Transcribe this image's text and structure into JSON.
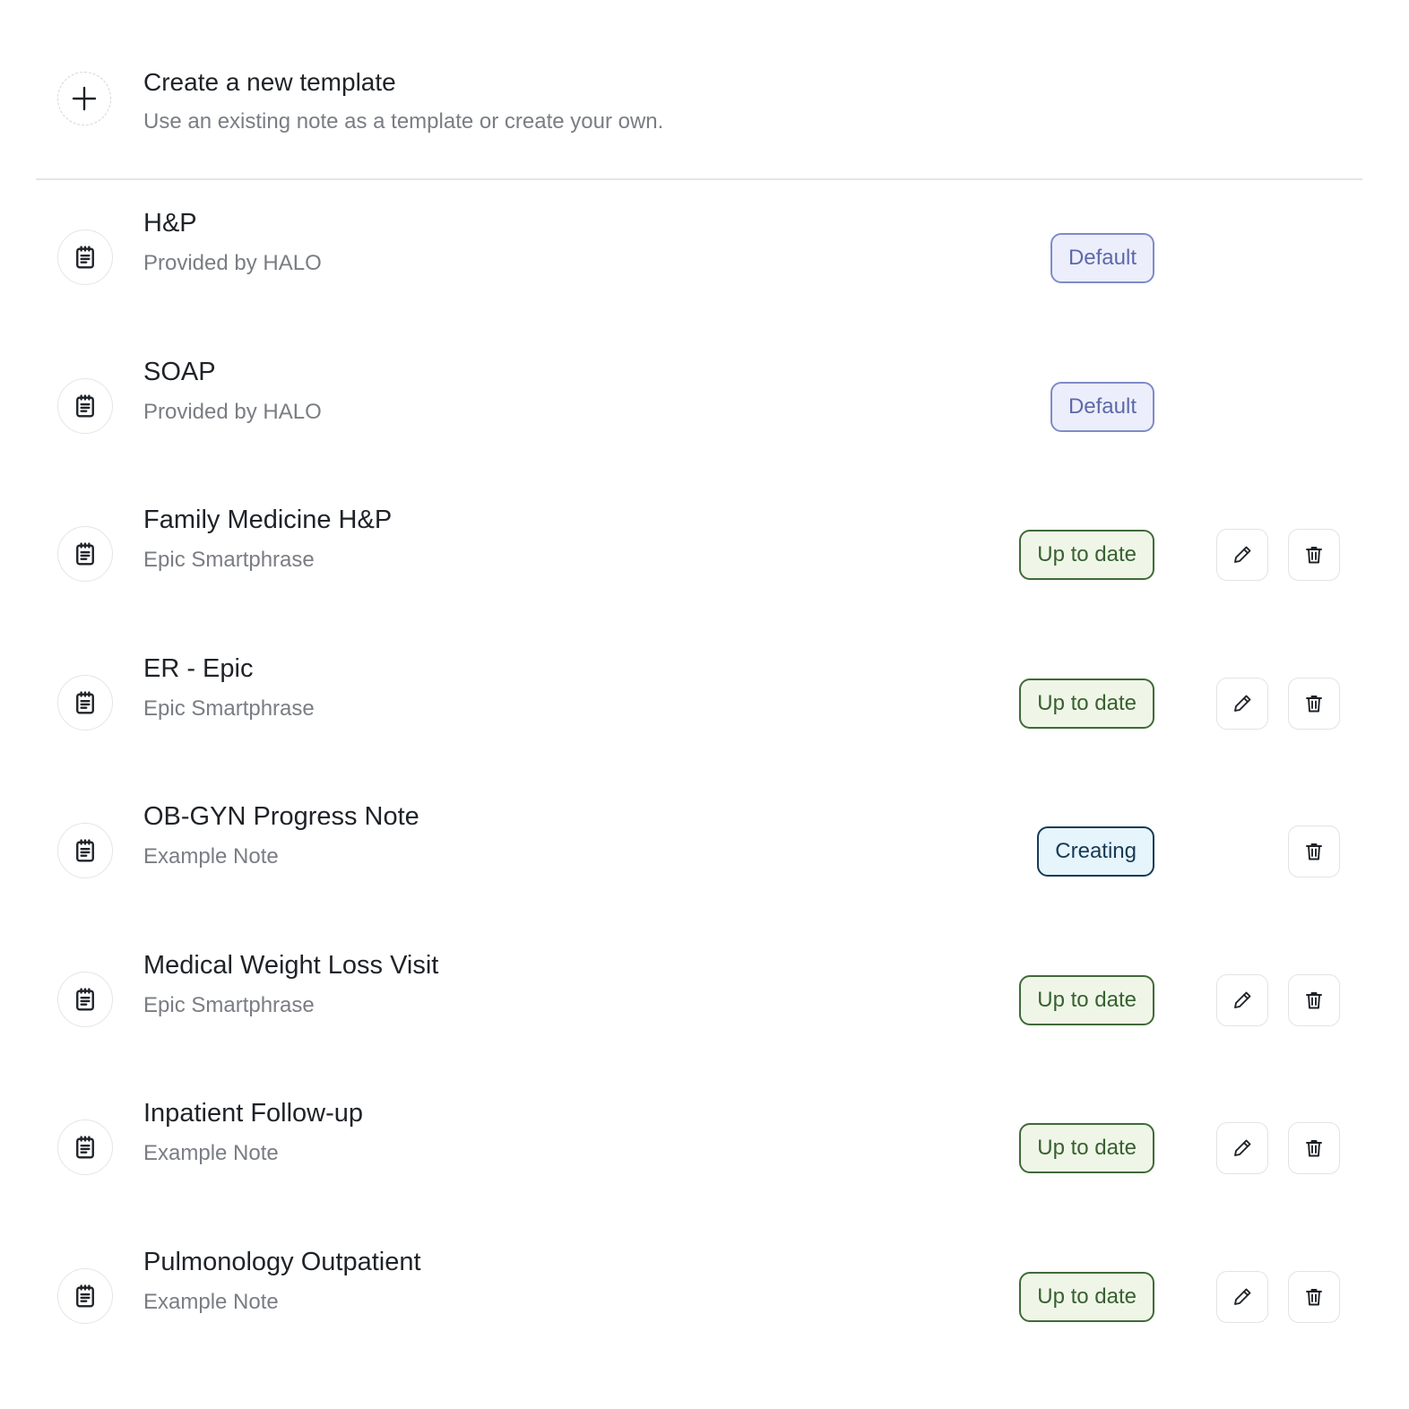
{
  "create": {
    "title": "Create a new template",
    "subtitle": "Use an existing note as a template or create your own.",
    "icon": "plus-icon"
  },
  "templates": [
    {
      "title": "H&P",
      "subtitle": "Provided by HALO",
      "badge": "Default",
      "status": "default",
      "editable": false,
      "deletable": false
    },
    {
      "title": "SOAP",
      "subtitle": "Provided by HALO",
      "badge": "Default",
      "status": "default",
      "editable": false,
      "deletable": false
    },
    {
      "title": "Family Medicine H&P",
      "subtitle": "Epic Smartphrase",
      "badge": "Up to date",
      "status": "uptodate",
      "editable": true,
      "deletable": true
    },
    {
      "title": "ER - Epic",
      "subtitle": "Epic Smartphrase",
      "badge": "Up to date",
      "status": "uptodate",
      "editable": true,
      "deletable": true
    },
    {
      "title": "OB-GYN Progress Note",
      "subtitle": "Example Note",
      "badge": "Creating",
      "status": "creating",
      "editable": false,
      "deletable": true
    },
    {
      "title": "Medical Weight Loss Visit",
      "subtitle": "Epic Smartphrase",
      "badge": "Up to date",
      "status": "uptodate",
      "editable": true,
      "deletable": true
    },
    {
      "title": "Inpatient Follow-up",
      "subtitle": "Example Note",
      "badge": "Up to date",
      "status": "uptodate",
      "editable": true,
      "deletable": true
    },
    {
      "title": "Pulmonology Outpatient",
      "subtitle": "Example Note",
      "badge": "Up to date",
      "status": "uptodate",
      "editable": true,
      "deletable": true
    }
  ],
  "icons": {
    "template": "clipboard-icon",
    "edit": "pencil-icon",
    "delete": "trash-icon"
  },
  "colors": {
    "default_badge_bg": "#eceefb",
    "default_badge_border": "#7f8bc8",
    "uptodate_badge_bg": "#eff6e8",
    "uptodate_badge_border": "#3f6a38",
    "creating_badge_bg": "#e6f4fb",
    "creating_badge_border": "#173a55"
  }
}
